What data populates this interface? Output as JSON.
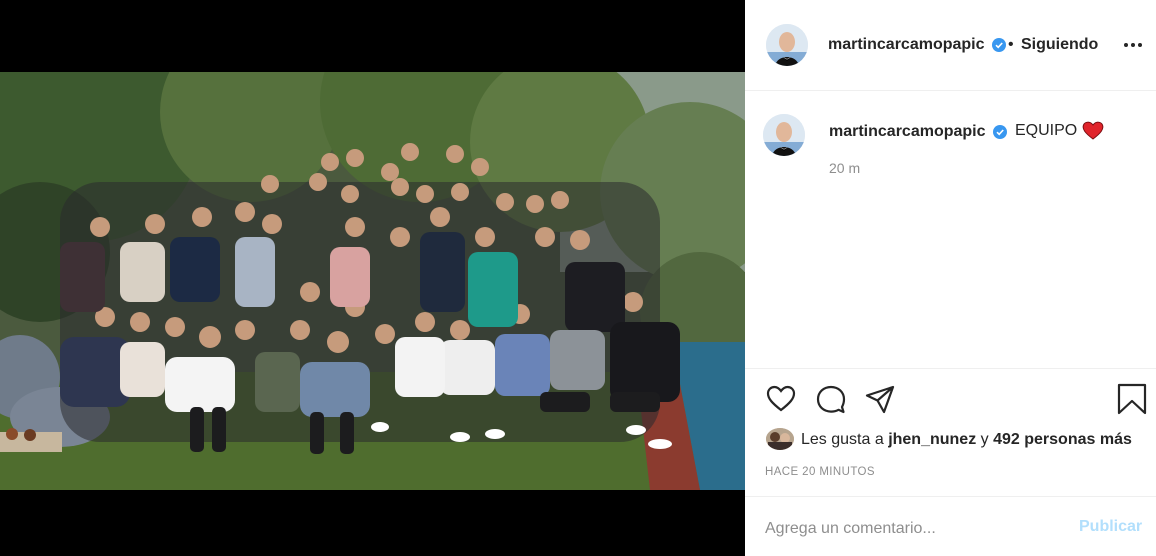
{
  "post": {
    "photo_description": "group-photo",
    "author": {
      "username": "martincarcamopapic",
      "verified": true,
      "follow_separator": "•",
      "follow_status": "Siguiendo"
    },
    "caption": {
      "username": "martincarcamopapic",
      "text": "EQUIPO",
      "emoji": "red-heart",
      "time_ago": "20 m"
    },
    "actions": {
      "like": "heart-outline-icon",
      "comment": "comment-bubble-icon",
      "share": "paper-plane-icon",
      "save": "bookmark-icon"
    },
    "likes": {
      "prefix": "Les gusta a",
      "liker": "jhen_nunez",
      "joiner": "y",
      "others": "492 personas más"
    },
    "timestamp": "HACE 20 MINUTOS",
    "comment_box": {
      "placeholder": "Agrega un comentario...",
      "submit_label": "Publicar"
    }
  },
  "colors": {
    "verified_blue": "#3897f0",
    "heart_red": "#ed4956",
    "muted_text": "#8e8e8e",
    "publish_disabled": "#b2dffc"
  }
}
